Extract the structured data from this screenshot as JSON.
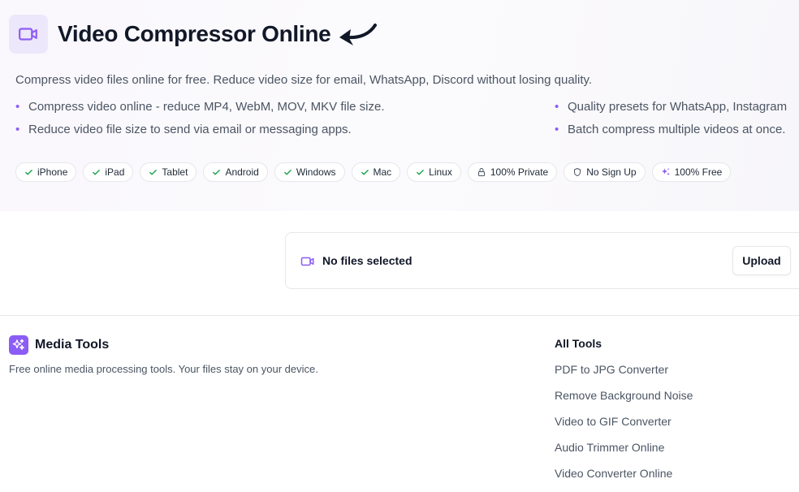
{
  "header": {
    "title": "Video Compressor Online",
    "subtitle": "Compress video files online for free. Reduce video size for email, WhatsApp, Discord without losing quality."
  },
  "features": {
    "left": [
      "Compress video online - reduce MP4, WebM, MOV, MKV file size.",
      "Reduce video file size to send via email or messaging apps."
    ],
    "right": [
      "Quality presets for WhatsApp, Instagram",
      "Batch compress multiple videos at once."
    ]
  },
  "badges": [
    {
      "label": "iPhone",
      "icon": "check-icon"
    },
    {
      "label": "iPad",
      "icon": "check-icon"
    },
    {
      "label": "Tablet",
      "icon": "check-icon"
    },
    {
      "label": "Android",
      "icon": "check-icon"
    },
    {
      "label": "Windows",
      "icon": "check-icon"
    },
    {
      "label": "Mac",
      "icon": "check-icon"
    },
    {
      "label": "Linux",
      "icon": "check-icon"
    },
    {
      "label": "100% Private",
      "icon": "lock-icon"
    },
    {
      "label": "No Sign Up",
      "icon": "shield-icon"
    },
    {
      "label": "100% Free",
      "icon": "sparkles-icon"
    }
  ],
  "uploader": {
    "status": "No files selected",
    "upload_label": "Upload"
  },
  "footer": {
    "brand": "Media Tools",
    "description": "Free online media processing tools. Your files stay on your device.",
    "links_heading": "All Tools",
    "links": [
      "PDF to JPG Converter",
      "Remove Background Noise",
      "Video to GIF Converter",
      "Audio Trimmer Online",
      "Video Converter Online"
    ]
  },
  "colors": {
    "accent": "#8b5cf6",
    "accent_light": "#ede7fb",
    "check": "#16a34a"
  }
}
